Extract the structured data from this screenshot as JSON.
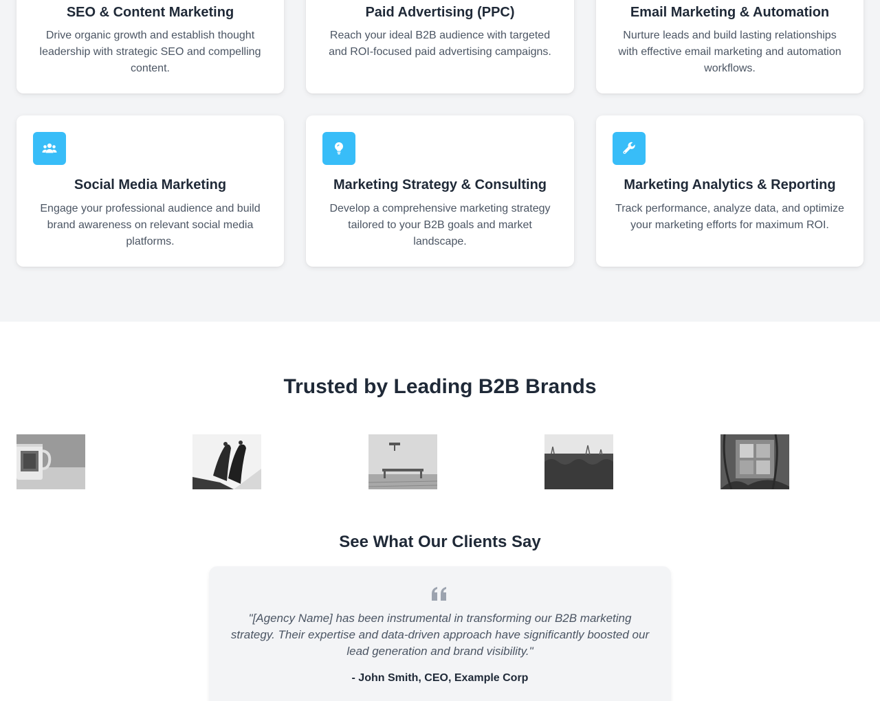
{
  "services": [
    {
      "title": "SEO & Content Marketing",
      "description": "Drive organic growth and establish thought leadership with strategic SEO and compelling content."
    },
    {
      "title": "Paid Advertising (PPC)",
      "description": "Reach your ideal B2B audience with targeted and ROI-focused paid advertising campaigns."
    },
    {
      "title": "Email Marketing & Automation",
      "description": "Nurture leads and build lasting relationships with effective email marketing and automation workflows."
    },
    {
      "title": "Social Media Marketing",
      "description": "Engage your professional audience and build brand awareness on relevant social media platforms.",
      "icon": "users-icon"
    },
    {
      "title": "Marketing Strategy & Consulting",
      "description": "Develop a comprehensive marketing strategy tailored to your B2B goals and market landscape.",
      "icon": "lightbulb-icon"
    },
    {
      "title": "Marketing Analytics & Reporting",
      "description": "Track performance, analyze data, and optimize your marketing efforts for maximum ROI.",
      "icon": "wrench-icon"
    }
  ],
  "trusted": {
    "title": "Trusted by Leading B2B Brands"
  },
  "testimonials": {
    "title": "See What Our Clients Say",
    "quote": "\"[Agency Name] has been instrumental in transforming our B2B marketing strategy. Their expertise and data-driven approach have significantly boosted our lead generation and brand visibility.\"",
    "author": "- John Smith, CEO, Example Corp"
  },
  "colors": {
    "accent": "#38bdf8",
    "section_bg": "#f3f4f6",
    "heading": "#1f2937",
    "body_text": "#4b5563"
  }
}
